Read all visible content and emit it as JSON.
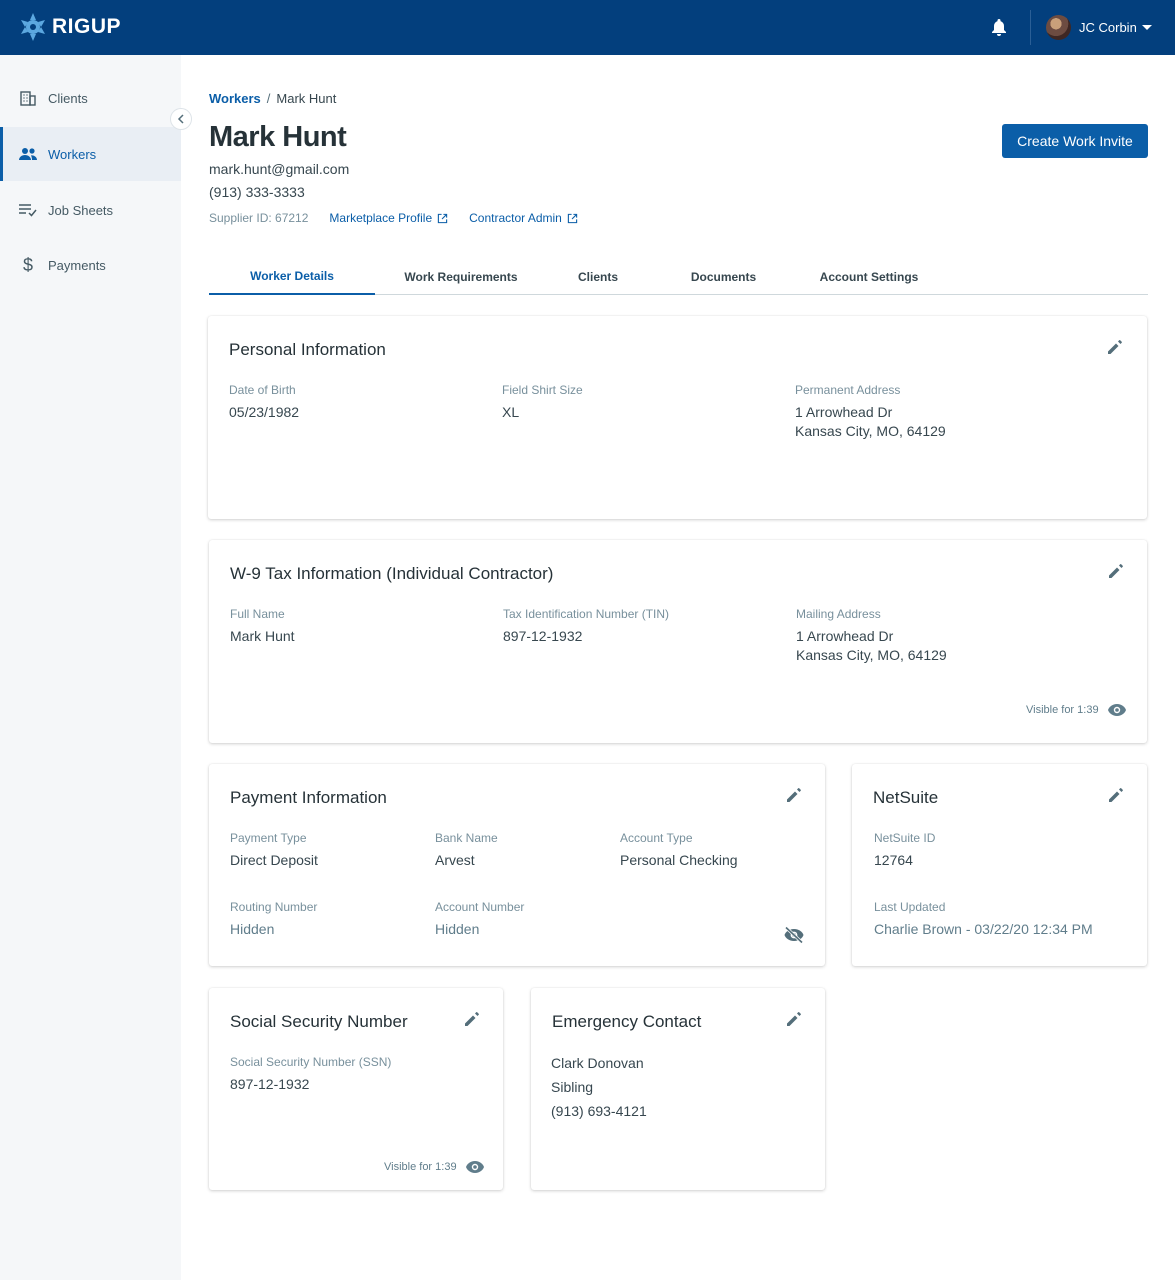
{
  "brand": {
    "name": "RIGUP",
    "primary": "#033f7d",
    "accent": "#0b5ea8"
  },
  "header": {
    "user_name": "JC Corbin",
    "icons": [
      "bell-icon",
      "avatar",
      "caret-down-icon"
    ]
  },
  "sidebar": {
    "items": [
      {
        "label": "Clients",
        "icon": "building-icon"
      },
      {
        "label": "Workers",
        "icon": "people-icon",
        "active": true
      },
      {
        "label": "Job Sheets",
        "icon": "list-check-icon"
      },
      {
        "label": "Payments",
        "icon": "dollar-icon"
      }
    ]
  },
  "breadcrumb": {
    "parent": "Workers",
    "separator": "/",
    "current": "Mark Hunt"
  },
  "worker": {
    "name": "Mark Hunt",
    "email": "mark.hunt@gmail.com",
    "phone": "(913) 333-3333",
    "supplier_id": "Supplier ID: 67212",
    "marketplace_link": "Marketplace Profile",
    "contractor_link": "Contractor Admin"
  },
  "actions": {
    "create_invite": "Create Work Invite"
  },
  "tabs": [
    {
      "label": "Worker Details",
      "active": true
    },
    {
      "label": "Work Requirements"
    },
    {
      "label": "Clients"
    },
    {
      "label": "Documents"
    },
    {
      "label": "Account Settings"
    }
  ],
  "personal": {
    "title": "Personal Information",
    "dob_label": "Date of Birth",
    "dob": "05/23/1982",
    "shirt_label": "Field Shirt Size",
    "shirt": "XL",
    "address_label": "Permanent Address",
    "address_line1": "1 Arrowhead Dr",
    "address_line2": "Kansas City, MO, 64129"
  },
  "w9": {
    "title": "W-9 Tax Information (Individual Contractor)",
    "name_label": "Full Name",
    "name": "Mark Hunt",
    "tin_label": "Tax Identification Number (TIN)",
    "tin": "897-12-1932",
    "mail_label": "Mailing Address",
    "mail_line1": "1 Arrowhead Dr",
    "mail_line2": "Kansas City, MO, 64129",
    "visible_for": "Visible for 1:39"
  },
  "payment": {
    "title": "Payment Information",
    "type_label": "Payment Type",
    "type": "Direct Deposit",
    "bank_label": "Bank Name",
    "bank": "Arvest",
    "acct_type_label": "Account Type",
    "acct_type": "Personal Checking",
    "routing_label": "Routing Number",
    "routing": "Hidden",
    "acct_num_label": "Account Number",
    "acct_num": "Hidden"
  },
  "netsuite": {
    "title": "NetSuite",
    "id_label": "NetSuite ID",
    "id": "12764",
    "updated_label": "Last Updated",
    "updated": "Charlie Brown - 03/22/20 12:34 PM"
  },
  "ssn": {
    "title": "Social Security Number",
    "label": "Social Security Number (SSN)",
    "value": "897-12-1932",
    "visible_for": "Visible for 1:39"
  },
  "emergency": {
    "title": "Emergency Contact",
    "name": "Clark Donovan",
    "relation": "Sibling",
    "phone": "(913) 693-4121"
  }
}
